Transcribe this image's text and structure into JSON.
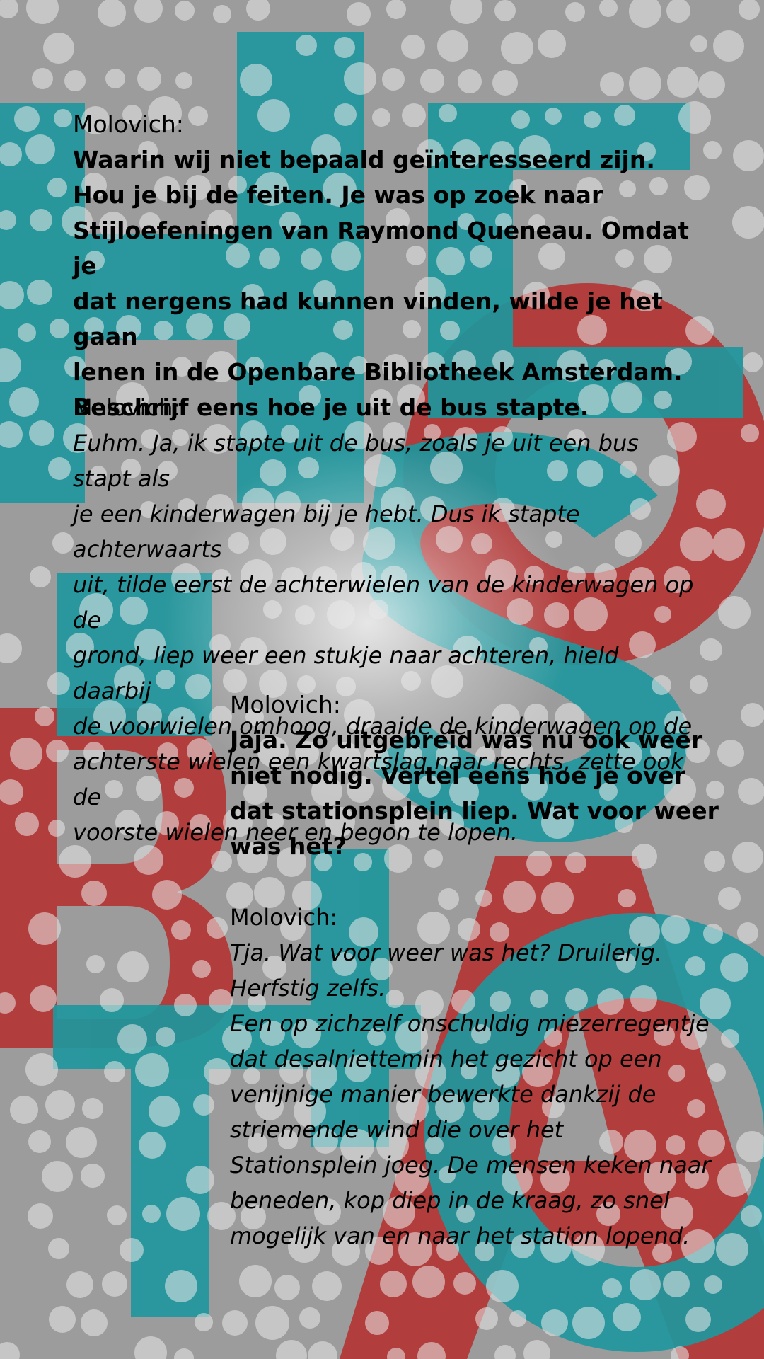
{
  "blocks": [
    {
      "speaker": "Molovich:",
      "style": "bold",
      "lines": [
        "Waarin wij niet bepaald geïnteresseerd zijn.",
        "Hou je bij de feiten. Je was op zoek naar",
        "Stijloefeningen van Raymond Queneau. Omdat je",
        "dat nergens had kunnen vinden, wilde je het gaan",
        "lenen in de Openbare Bibliotheek Amsterdam.",
        "Beschrijf eens hoe je uit de bus stapte."
      ]
    },
    {
      "speaker": "Molovich:",
      "style": "italic",
      "lines": [
        "Euhm. Ja, ik stapte uit de bus, zoals je uit een bus stapt als",
        "je een kinderwagen bij je hebt. Dus ik stapte achterwaarts",
        "uit, tilde eerst de achterwielen van de kinderwagen op de",
        "grond, liep weer een stukje naar achteren, hield daarbij",
        "de voorwielen omhoog, draaide de kinderwagen op de",
        "achterste wielen een kwartslag naar rechts, zette ook de",
        "voorste wielen neer en begon te lopen."
      ]
    },
    {
      "speaker": "Molovich:",
      "style": "bold",
      "lines": [
        "Jaja. Zo uitgebreid was nu ook weer",
        "niet nodig. Vertel eens hoe je over",
        "dat stationsplein liep. Wat voor weer",
        "was het?"
      ]
    },
    {
      "speaker": "Molovich:",
      "style": "italic",
      "lines": [
        "Tja. Wat voor weer was het? Druilerig.",
        "Herfstig zelfs.",
        "Een op zichzelf onschuldig miezerregentje",
        "dat desalniettemin het gezicht op een",
        "venijnige manier bewerkte dankzij de",
        "striemende wind die over het",
        "Stationsplein joeg. De mensen keken naar",
        "beneden, kop diep in de kraag, zo snel",
        "mogelijk van en naar het station lopend."
      ]
    }
  ],
  "colors": {
    "background": "#9c9c9c",
    "teal": "#1f9aa0",
    "red": "#b73a3a",
    "dots": "#e6e6e6",
    "text": "#000000"
  }
}
